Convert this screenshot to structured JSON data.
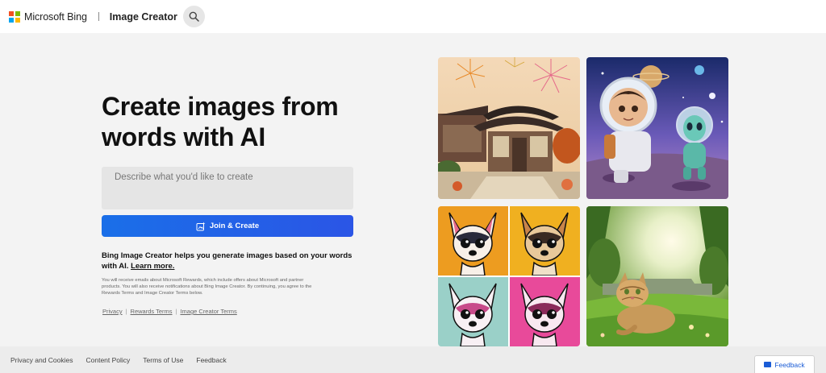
{
  "brand": {
    "logo_text": "Microsoft Bing",
    "logo_colors": [
      "#f25022",
      "#7fba00",
      "#00a4ef",
      "#ffb900"
    ],
    "app_title": "Image Creator"
  },
  "hero": {
    "title": "Create images from words with AI"
  },
  "prompt": {
    "placeholder": "Describe what you'd like to create"
  },
  "join_button": {
    "label": "Join & Create",
    "color": "#1a6fe8"
  },
  "description": {
    "text": "Bing Image Creator helps you generate images based on your words with AI.",
    "link": "Learn more."
  },
  "fine_print": "You will receive emails about Microsoft Rewards, which include offers about Microsoft and partner products. You will also receive notifications about Bing Image Creator. By continuing, you agree to the Rewards Terms and Image Creator Terms below.",
  "legal_links": [
    "Privacy",
    "Rewards Terms",
    "Image Creator Terms"
  ],
  "footer": {
    "links": [
      "Privacy and Cookies",
      "Content Policy",
      "Terms of Use",
      "Feedback"
    ],
    "feedback_button": "Feedback"
  },
  "gallery": [
    "pagoda-fireworks-image",
    "astronaut-alien-image",
    "chihuahua-pop-art-image",
    "cat-garden-image"
  ]
}
